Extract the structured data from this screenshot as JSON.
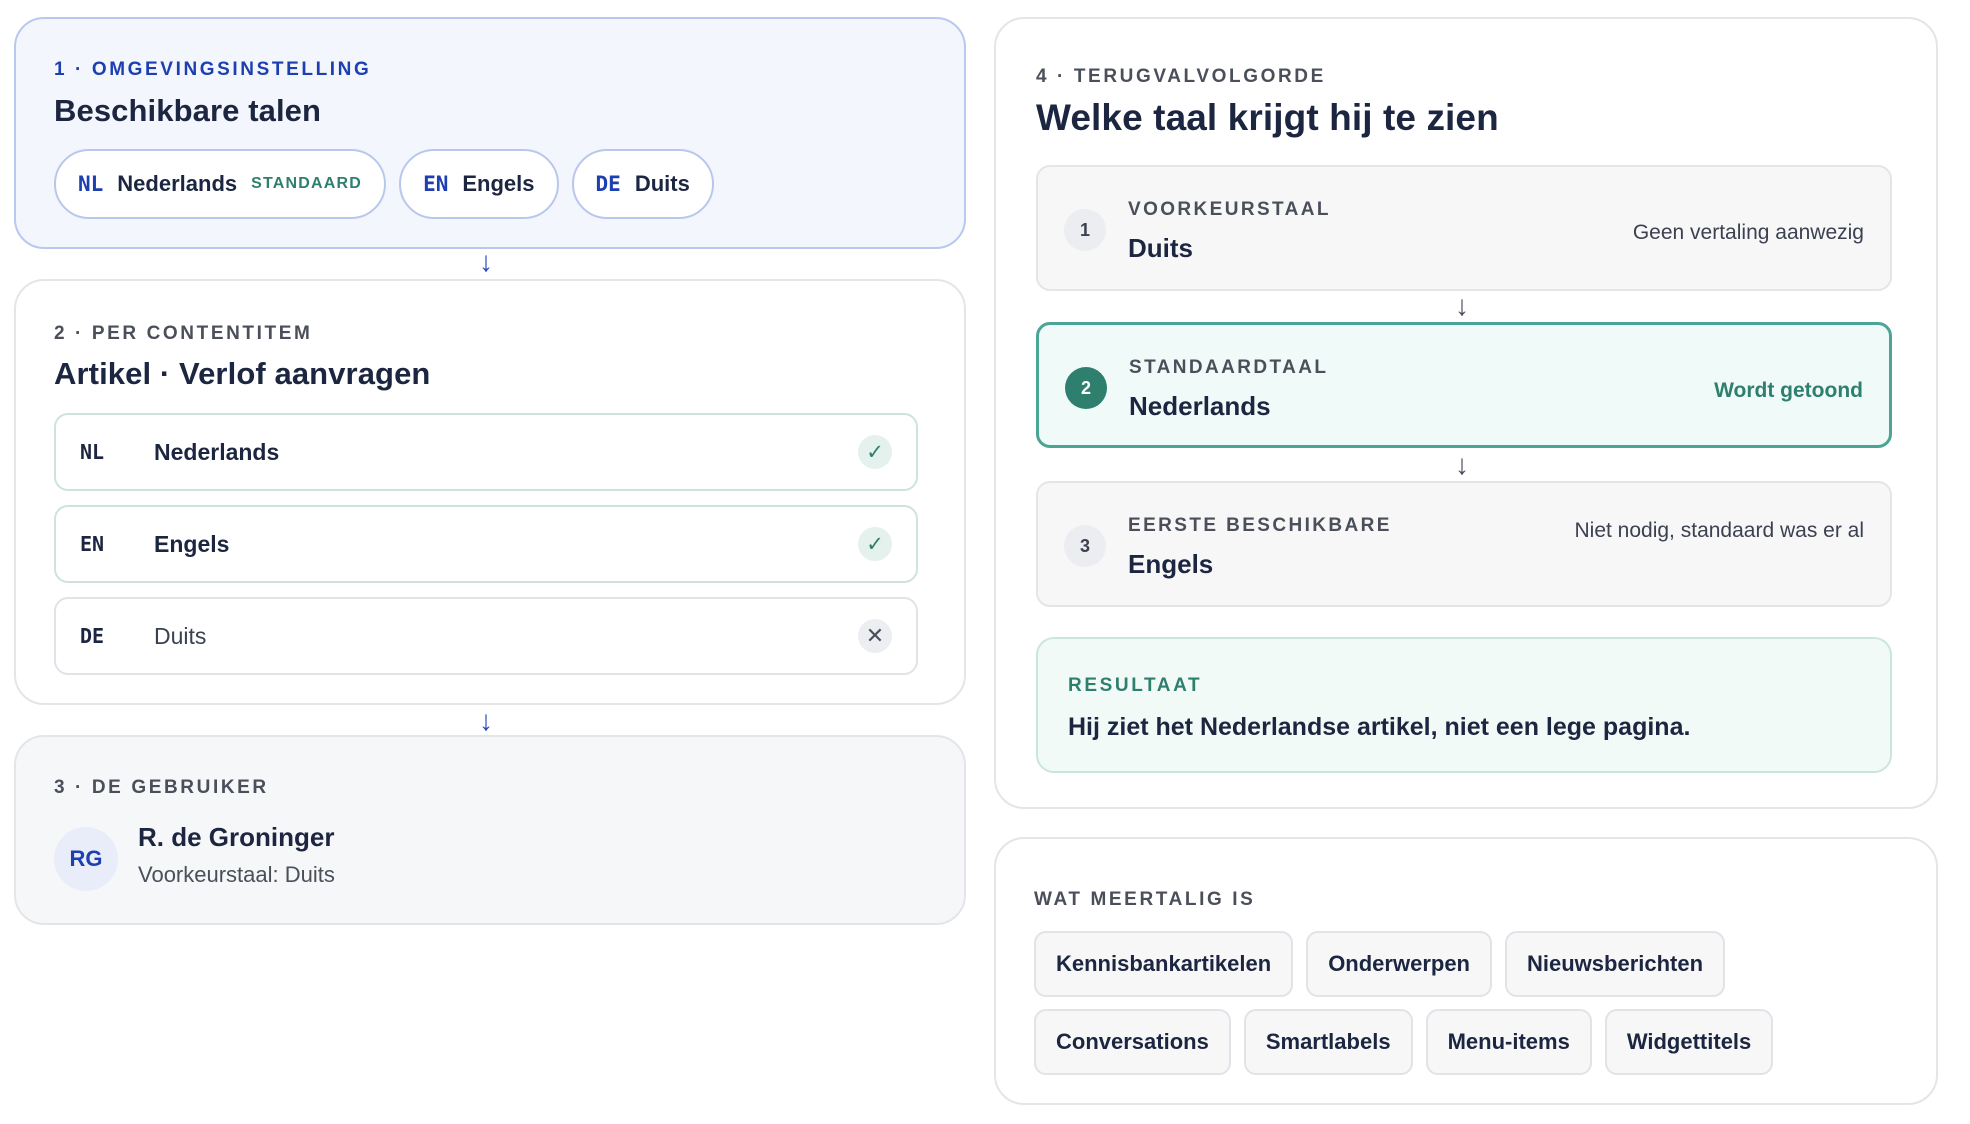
{
  "section1": {
    "eyebrow": "1 · Omgevingsinstelling",
    "title": "Beschikbare talen",
    "languages": [
      {
        "code": "NL",
        "name": "Nederlands",
        "tag": "STANDAARD"
      },
      {
        "code": "EN",
        "name": "Engels",
        "tag": ""
      },
      {
        "code": "DE",
        "name": "Duits",
        "tag": ""
      }
    ]
  },
  "section2": {
    "eyebrow": "2 · Per contentitem",
    "title": "Artikel · Verlof aanvragen",
    "rows": [
      {
        "code": "NL",
        "name": "Nederlands",
        "status": "available",
        "status_icon": "check-icon"
      },
      {
        "code": "EN",
        "name": "Engels",
        "status": "available",
        "status_icon": "check-icon"
      },
      {
        "code": "DE",
        "name": "Duits",
        "status": "missing",
        "status_icon": "cross-icon"
      }
    ]
  },
  "section3": {
    "eyebrow": "3 · De gebruiker",
    "initials": "RG",
    "name": "R. de Groninger",
    "preference": "Voorkeurstaal: Duits"
  },
  "section4": {
    "eyebrow": "4 · Terugvalvolgorde",
    "title": "Welke taal krijgt hij te zien",
    "steps": [
      {
        "number": "1",
        "label": "Voorkeurstaal",
        "language": "Duits",
        "note": "Geen vertaling aanwezig"
      },
      {
        "number": "2",
        "label": "Standaardtaal",
        "language": "Nederlands",
        "note": "Wordt getoond"
      },
      {
        "number": "3",
        "label": "Eerste beschikbare",
        "language": "Engels",
        "note": "Niet nodig, standaard was er al"
      }
    ],
    "result": {
      "eyebrow": "Resultaat",
      "text": "Hij ziet het Nederlandse artikel, niet een lege pagina."
    }
  },
  "multilingual": {
    "eyebrow": "Wat meertalig is",
    "items": [
      "Kennisbankartikelen",
      "Onderwerpen",
      "Nieuwsberichten",
      "Conversations",
      "Smartlabels",
      "Menu-items",
      "Widgettitels"
    ]
  },
  "colors": {
    "accent_blue": "#1d3fb0",
    "accent_teal": "#2f7f6e",
    "text_dark": "#1c2640"
  }
}
